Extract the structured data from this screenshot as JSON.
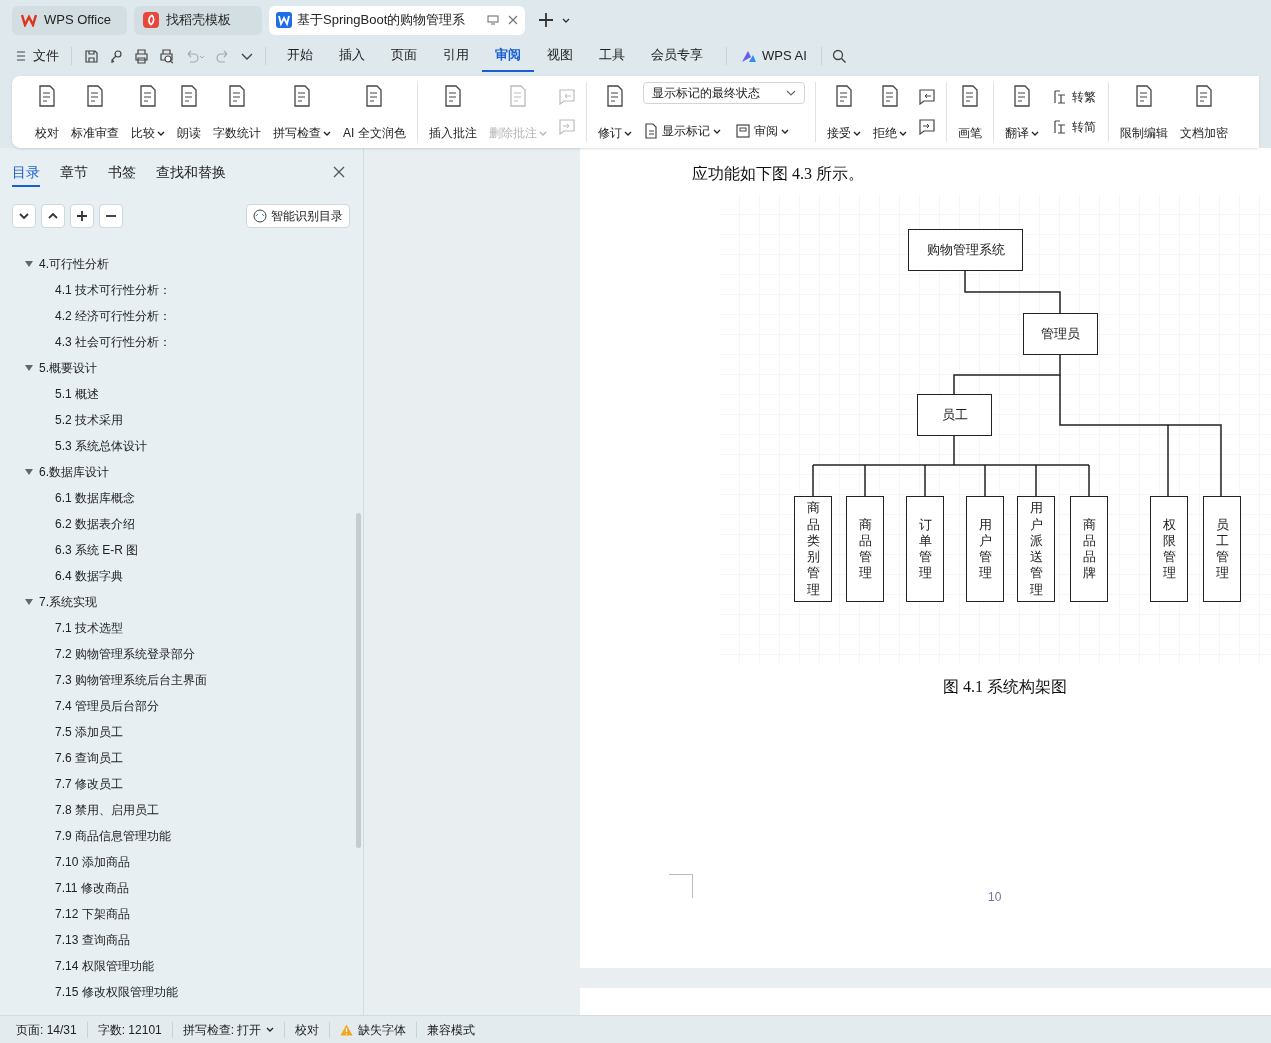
{
  "app_tabs": [
    {
      "label": "WPS Office",
      "selected": false
    },
    {
      "label": "找稻壳模板",
      "selected": false
    },
    {
      "label": "基于SpringBoot的购物管理系",
      "selected": true
    }
  ],
  "menu": {
    "file": "文件",
    "tabs": [
      {
        "label": "开始",
        "selected": false
      },
      {
        "label": "插入",
        "selected": false
      },
      {
        "label": "页面",
        "selected": false
      },
      {
        "label": "引用",
        "selected": false
      },
      {
        "label": "审阅",
        "selected": true
      },
      {
        "label": "视图",
        "selected": false
      },
      {
        "label": "工具",
        "selected": false
      },
      {
        "label": "会员专享",
        "selected": false
      }
    ],
    "ai": "WPS AI"
  },
  "ribbon": {
    "groups": [
      {
        "items": [
          {
            "kind": "large",
            "label": "校对",
            "dropdown": false,
            "disabled": false
          },
          {
            "kind": "large",
            "label": "标准审查",
            "dropdown": false,
            "disabled": false
          },
          {
            "kind": "large",
            "label": "比较",
            "dropdown": true,
            "disabled": false
          },
          {
            "kind": "large",
            "label": "朗读",
            "dropdown": false,
            "disabled": false
          },
          {
            "kind": "large",
            "label": "字数统计",
            "dropdown": false,
            "disabled": false
          },
          {
            "kind": "large",
            "label": "拼写检查",
            "dropdown": true,
            "disabled": false
          },
          {
            "kind": "large",
            "label": "AI 全文润色",
            "dropdown": false,
            "disabled": false
          }
        ]
      },
      {
        "items": [
          {
            "kind": "large",
            "label": "插入批注",
            "dropdown": false,
            "disabled": false
          },
          {
            "kind": "large",
            "label": "删除批注",
            "dropdown": true,
            "disabled": true
          },
          {
            "kind": "icon_pair",
            "disabled": true
          }
        ]
      },
      {
        "items": [
          {
            "kind": "large",
            "label": "修订",
            "dropdown": true,
            "disabled": false
          },
          {
            "kind": "select_panel",
            "value": "显示标记的最终状态",
            "buttons": [
              {
                "label": "显示标记",
                "dropdown": true
              },
              {
                "label": "审阅",
                "dropdown": true
              }
            ]
          }
        ]
      },
      {
        "items": [
          {
            "kind": "large",
            "label": "接受",
            "dropdown": true,
            "disabled": false
          },
          {
            "kind": "large",
            "label": "拒绝",
            "dropdown": true,
            "disabled": false
          },
          {
            "kind": "icon_pair",
            "disabled": false
          }
        ]
      },
      {
        "items": [
          {
            "kind": "large",
            "label": "画笔",
            "dropdown": false,
            "disabled": false
          }
        ]
      },
      {
        "items": [
          {
            "kind": "large",
            "label": "翻译",
            "dropdown": true,
            "disabled": false
          },
          {
            "kind": "label_pair",
            "labels": [
              "转繁",
              "转简"
            ]
          }
        ]
      },
      {
        "items": [
          {
            "kind": "large",
            "label": "限制编辑",
            "dropdown": false,
            "disabled": false
          },
          {
            "kind": "large",
            "label": "文档加密",
            "dropdown": false,
            "disabled": false
          }
        ]
      }
    ]
  },
  "nav_pane": {
    "tabs": [
      {
        "label": "目录",
        "selected": true
      },
      {
        "label": "章节",
        "selected": false
      },
      {
        "label": "书签",
        "selected": false
      },
      {
        "label": "查找和替换",
        "selected": false
      }
    ],
    "smart_button": "智能识别目录",
    "outline": [
      {
        "label": "4.可行性分析",
        "expanded": true,
        "children": [
          {
            "label": "4.1 技术可行性分析："
          },
          {
            "label": "4.2 经济可行性分析："
          },
          {
            "label": "4.3 社会可行性分析："
          }
        ]
      },
      {
        "label": "5.概要设计",
        "expanded": true,
        "children": [
          {
            "label": "5.1 概述"
          },
          {
            "label": "5.2 技术采用"
          },
          {
            "label": "5.3 系统总体设计"
          }
        ]
      },
      {
        "label": "6.数据库设计",
        "expanded": true,
        "children": [
          {
            "label": "6.1 数据库概念"
          },
          {
            "label": "6.2 数据表介绍"
          },
          {
            "label": "6.3 系统 E-R 图"
          },
          {
            "label": "6.4 数据字典"
          }
        ]
      },
      {
        "label": "7.系统实现",
        "expanded": true,
        "children": [
          {
            "label": "7.1 技术选型"
          },
          {
            "label": "7.2 购物管理系统登录部分"
          },
          {
            "label": "7.3 购物管理系统后台主界面"
          },
          {
            "label": "7.4 管理员后台部分"
          },
          {
            "label": "7.5 添加员工"
          },
          {
            "label": "7.6 查询员工"
          },
          {
            "label": "7.7 修改员工"
          },
          {
            "label": "7.8 禁用、启用员工"
          },
          {
            "label": "7.9 商品信息管理功能"
          },
          {
            "label": "7.10 添加商品"
          },
          {
            "label": "7.11 修改商品"
          },
          {
            "label": "7.12 下架商品"
          },
          {
            "label": "7.13 查询商品"
          },
          {
            "label": "7.14 权限管理功能"
          },
          {
            "label": "7.15 修改权限管理功能"
          }
        ]
      }
    ]
  },
  "document": {
    "paragraph": "应功能如下图 4.3 所示。",
    "diagram": {
      "nodes": [
        {
          "label": "购物管理系统",
          "kind": "box"
        },
        {
          "label": "管理员",
          "kind": "box"
        },
        {
          "label": "员工",
          "kind": "box"
        },
        {
          "label": "商品类别管理",
          "kind": "vertical_box"
        },
        {
          "label": "商品管理",
          "kind": "vertical_box"
        },
        {
          "label": "订单管理",
          "kind": "vertical_box"
        },
        {
          "label": "用户管理",
          "kind": "vertical_box"
        },
        {
          "label": "用户派送管理",
          "kind": "vertical_box"
        },
        {
          "label": "商品品牌",
          "kind": "vertical_box"
        },
        {
          "label": "权限管理",
          "kind": "vertical_box"
        },
        {
          "label": "员工管理",
          "kind": "vertical_box"
        }
      ]
    },
    "caption": "图 4.1 系统构架图",
    "page_number": "10"
  },
  "status_bar": [
    {
      "kind": "text",
      "label": "页面: 14/31"
    },
    {
      "kind": "text",
      "label": "字数: 12101"
    },
    {
      "kind": "dropdown",
      "label": "拼写检查: 打开"
    },
    {
      "kind": "text",
      "label": "校对"
    },
    {
      "kind": "warning",
      "label": "缺失字体"
    },
    {
      "kind": "text",
      "label": "兼容模式"
    }
  ]
}
